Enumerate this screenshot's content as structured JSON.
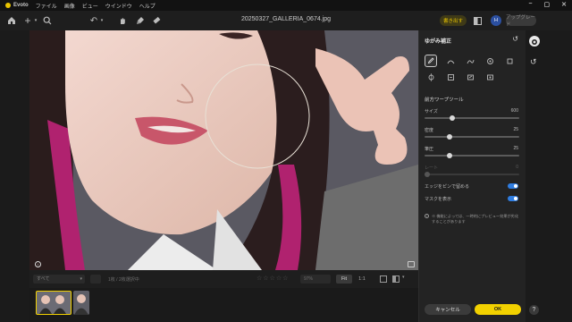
{
  "menubar": {
    "app_name": "Evoto",
    "items": [
      "ファイル",
      "画像",
      "ビュー",
      "ウインドウ",
      "ヘルプ"
    ]
  },
  "toolbar": {
    "file_title": "20250327_GALLERIA_0674.jpg",
    "export_label": "書き出す",
    "user_initial": "H",
    "upgrade_label": "アップグレード"
  },
  "panel": {
    "title": "ゆがみ補正",
    "section_title": "前方ワープツール",
    "sliders": [
      {
        "label": "サイズ",
        "value": "600",
        "fraction": 0.28
      },
      {
        "label": "密度",
        "value": "25",
        "fraction": 0.25
      },
      {
        "label": "筆圧",
        "value": "25",
        "fraction": 0.25
      },
      {
        "label": "レート",
        "value": "0",
        "fraction": 0.0
      }
    ],
    "toggles": [
      {
        "label": "エッジをピンで留める",
        "on": true
      },
      {
        "label": "マスクを表示",
        "on": true
      }
    ],
    "note": "※ 機能によっては、一時的にプレビュー効果が劣化することがあります",
    "cancel_label": "キャンセル",
    "ok_label": "OK"
  },
  "bottombar": {
    "filter_value": "すべて",
    "count_text": "1枚 / 2枚選択中",
    "zoom_value": "97%",
    "fit_label": "Fit",
    "ratio_label": "1:1",
    "stars": [
      "☆",
      "☆",
      "☆",
      "☆",
      "☆"
    ]
  },
  "colors": {
    "accent_yellow": "#f2d100",
    "toggle_blue": "#2f7de1",
    "panel_bg": "#232323"
  }
}
